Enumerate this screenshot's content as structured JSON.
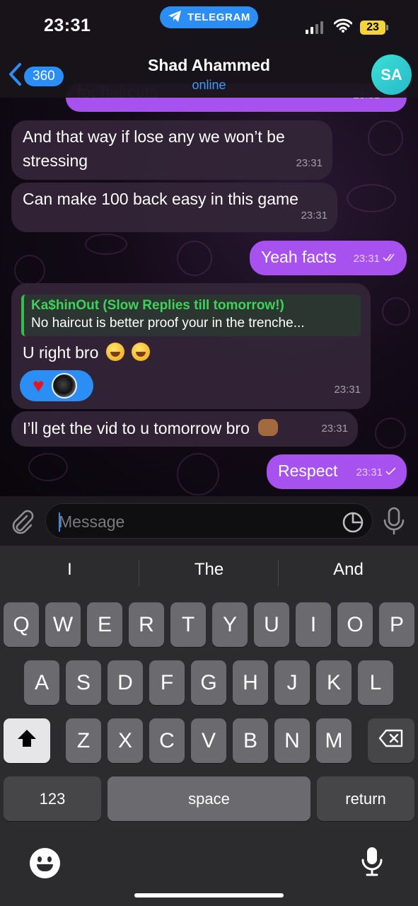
{
  "status_bar": {
    "time": "23:31",
    "app_pill": "TELEGRAM",
    "battery": "23",
    "accent": "#2a8ef5"
  },
  "header": {
    "back_count": "360",
    "contact_name": "Shad Ahammed",
    "contact_status": "online",
    "avatar_initials": "SA"
  },
  "messages": [
    {
      "direction": "out",
      "text": "for haircuts",
      "time": "23:31",
      "status": "read"
    },
    {
      "direction": "in",
      "text": "And that way if lose any we won’t be stressing",
      "time": "23:31"
    },
    {
      "direction": "in",
      "text": "Can make 100 back easy in this game",
      "time": "23:31"
    },
    {
      "direction": "out",
      "text": "Yeah facts",
      "time": "23:31",
      "status": "read"
    },
    {
      "direction": "in",
      "reply_to": {
        "name": "Ka$hinOut (Slow Replies till tomorrow!)",
        "text": "No haircut is better proof your in the trenche..."
      },
      "text": "U right bro",
      "emoji": "rolling-on-floor-laughing x2",
      "reaction": "red-heart",
      "time": "23:31"
    },
    {
      "direction": "in",
      "text": "I’ll get the vid to u tomorrow bro",
      "emoji": "oncoming-fist",
      "time": "23:31"
    },
    {
      "direction": "out",
      "text": "Respect",
      "time": "23:31",
      "status": "sent"
    }
  ],
  "composer": {
    "placeholder": "Message"
  },
  "keyboard": {
    "suggestions": [
      "I",
      "The",
      "And"
    ],
    "row1": [
      "Q",
      "W",
      "E",
      "R",
      "T",
      "Y",
      "U",
      "I",
      "O",
      "P"
    ],
    "row2": [
      "A",
      "S",
      "D",
      "F",
      "G",
      "H",
      "J",
      "K",
      "L"
    ],
    "row3": [
      "Z",
      "X",
      "C",
      "V",
      "B",
      "N",
      "M"
    ],
    "numbers_key": "123",
    "space_key": "space",
    "return_key": "return"
  },
  "colors": {
    "outgoing_bubble": "#a751ee",
    "incoming_bubble": "#342638",
    "reply_accent": "#33c04a",
    "keyboard_bg": "#2c2c2e"
  }
}
